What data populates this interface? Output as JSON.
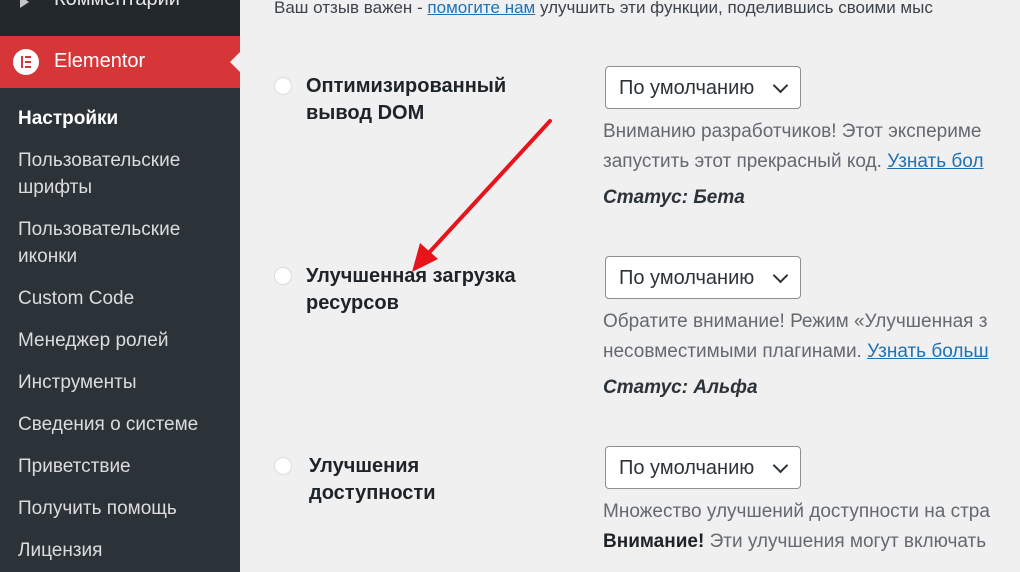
{
  "sidebar": {
    "top_item": "Комментарии",
    "active_item": "Elementor",
    "items": [
      {
        "label": "Настройки",
        "current": true
      },
      {
        "label": "Пользовательские шрифты"
      },
      {
        "label": "Пользовательские иконки"
      },
      {
        "label": "Custom Code"
      },
      {
        "label": "Менеджер ролей"
      },
      {
        "label": "Инструменты"
      },
      {
        "label": "Сведения о системе"
      },
      {
        "label": "Приветствие"
      },
      {
        "label": "Получить помощь"
      },
      {
        "label": "Лицензия"
      }
    ]
  },
  "intro": {
    "before": "Ваш отзыв важен - ",
    "link": "помогите нам",
    "after": " улучшить эти функции, поделившись своими мыс"
  },
  "experiments": [
    {
      "title": "Оптимизированный вывод DOM",
      "select_value": "По умолчанию",
      "desc_line1": "Вниманию разработчиков! Этот экспериме",
      "desc_line2_before": "запустить этот прекрасный код. ",
      "desc_link": "Узнать бол",
      "status": "Статус: Бета"
    },
    {
      "title": "Улучшенная загрузка ресурсов",
      "select_value": "По умолчанию",
      "desc_line1": "Обратите внимание! Режим «Улучшенная з",
      "desc_line2_before": "несовместимыми плагинами. ",
      "desc_link": "Узнать больш",
      "status": "Статус: Альфа"
    },
    {
      "title": "Улучшения доступности",
      "select_value": "По умолчанию",
      "desc_line1": "Множество улучшений доступности на стра",
      "desc_line2_bold": "Внимание!",
      "desc_line2_after": " Эти улучшения могут включать"
    }
  ],
  "colors": {
    "sidebar_bg": "#23282d",
    "active_bg": "#d63638",
    "link": "#2271b1",
    "annotation_arrow": "#e8141b"
  }
}
